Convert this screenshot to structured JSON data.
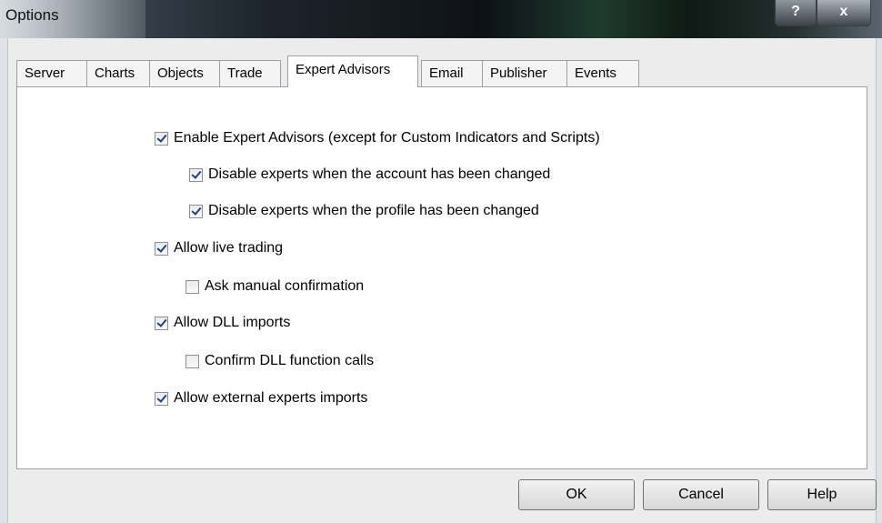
{
  "window": {
    "title": "Options",
    "help_glyph": "?",
    "close_glyph": "x"
  },
  "tabs": [
    "Server",
    "Charts",
    "Objects",
    "Trade",
    "Expert Advisors",
    "Email",
    "Publisher",
    "Events"
  ],
  "active_tab": "Expert Advisors",
  "options": [
    {
      "label": "Enable Expert Advisors (except for Custom Indicators and Scripts)",
      "checked": true
    },
    {
      "label": "Disable experts when the account has been changed",
      "checked": true
    },
    {
      "label": "Disable experts when the profile has been changed",
      "checked": true
    },
    {
      "label": "Allow live trading",
      "checked": true
    },
    {
      "label": "Ask manual confirmation",
      "checked": false
    },
    {
      "label": "Allow DLL imports",
      "checked": true
    },
    {
      "label": "Confirm DLL function calls",
      "checked": false
    },
    {
      "label": "Allow external experts imports",
      "checked": true
    }
  ],
  "buttons": {
    "ok": "OK",
    "cancel": "Cancel",
    "help": "Help"
  }
}
